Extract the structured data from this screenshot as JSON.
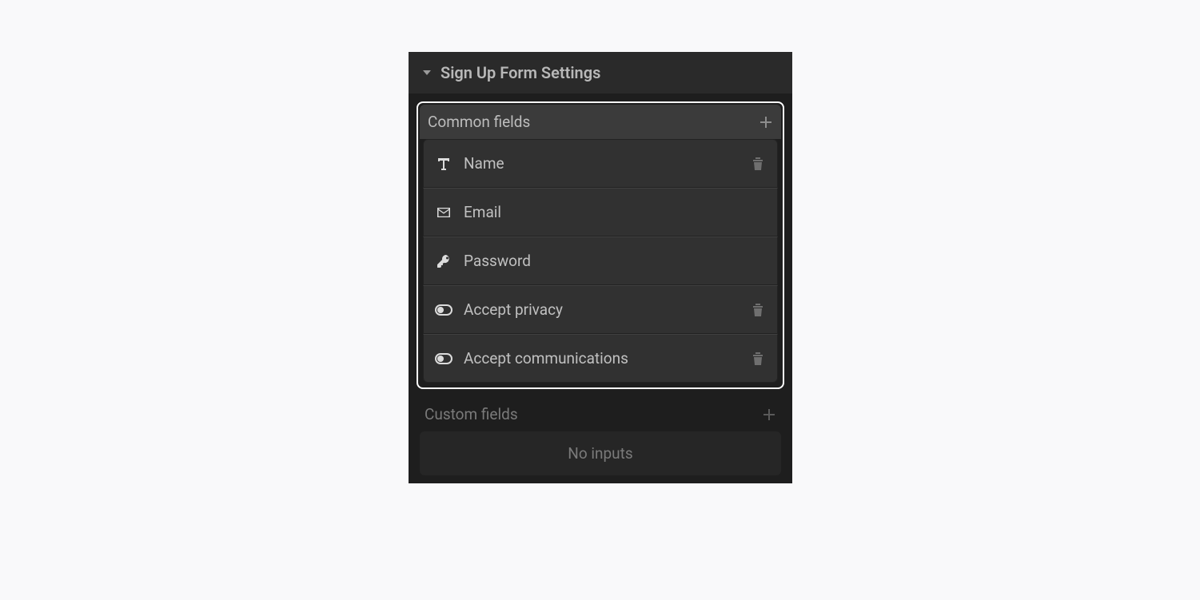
{
  "panel": {
    "title": "Sign Up Form Settings"
  },
  "commonFields": {
    "label": "Common fields",
    "items": [
      {
        "icon": "text-icon",
        "label": "Name",
        "deletable": true
      },
      {
        "icon": "envelope-icon",
        "label": "Email",
        "deletable": false
      },
      {
        "icon": "key-icon",
        "label": "Password",
        "deletable": false
      },
      {
        "icon": "toggle-icon",
        "label": "Accept privacy",
        "deletable": true
      },
      {
        "icon": "toggle-icon",
        "label": "Accept communications",
        "deletable": true
      }
    ]
  },
  "customFields": {
    "label": "Custom fields",
    "empty_label": "No inputs"
  }
}
